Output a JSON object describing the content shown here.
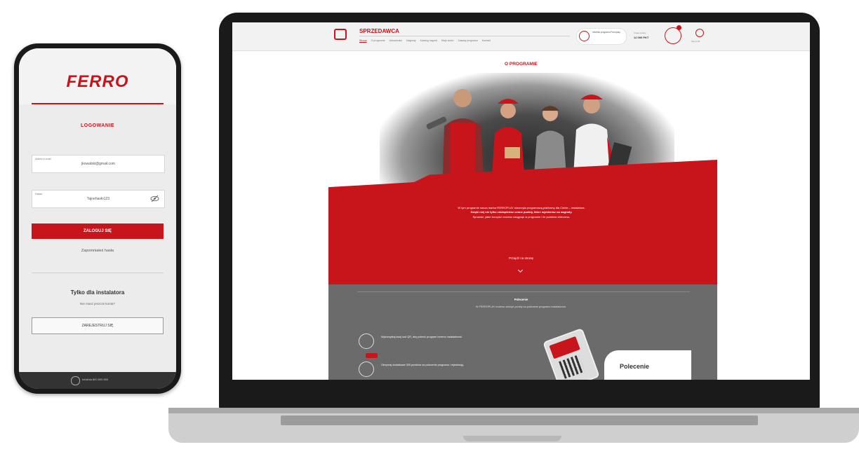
{
  "phone": {
    "logo": "FERRO",
    "login_title": "LOGOWANIE",
    "email_label": "Adres e-mail",
    "email_value": "jkowalski@gmail.com",
    "password_label": "Hasło",
    "password_value": "Tajnehasło123",
    "login_button": "ZALOGUJ SIĘ",
    "forgot_password": "Zapomniałeś hasła",
    "installers_title": "Tylko dla instalatora",
    "installers_sub": "Nie masz jeszcze konta?",
    "register_button": "ZAREJESTRUJ SIĘ",
    "footer_text": "Infolinia 800 800 800"
  },
  "site": {
    "brand": "SPRZEDAWCA",
    "nav": [
      "Strona",
      "O programie",
      "Aktualności",
      "Nagrody",
      "Katalog nagród",
      "Moje konto",
      "Zasady programu",
      "Kontakt"
    ],
    "hotline": "Infolinia programu Ferroplay",
    "points_label": "Twoje punkty",
    "points_value": "12 000 PKT",
    "user_label": "Mój profil",
    "section_title": "O PROGRAMIE",
    "intro_line1": "W tym programie nasza marka FERROPLAY stworzyła programową platformę dla Ciebie – instalatora.",
    "intro_line2": "Dzięki niej nie tylko zdobędziesz cenne punkty, które wymienisz na nagrody.",
    "intro_line3": "Sprawdź, jakie korzyści możesz osiągnąć w programie i ile punktów zbierzesz.",
    "more_link": "Przejdź na stronę",
    "panel_title": "Polecenie",
    "panel_sub": "W FERROPLAY możesz zdobyć punkty za polecenie programu instalatorom.",
    "benefit1": "Wykorzystaj swój kod QR, aby polecić program innemu instalatorowi.",
    "benefit2": "Otrzymaj dodatkowe 300 punktów za polecenie programu i rejestrację.",
    "card_title": "Polecenie"
  },
  "colors": {
    "brand_red": "#c8141b",
    "panel_gray": "#6b6b6b"
  }
}
